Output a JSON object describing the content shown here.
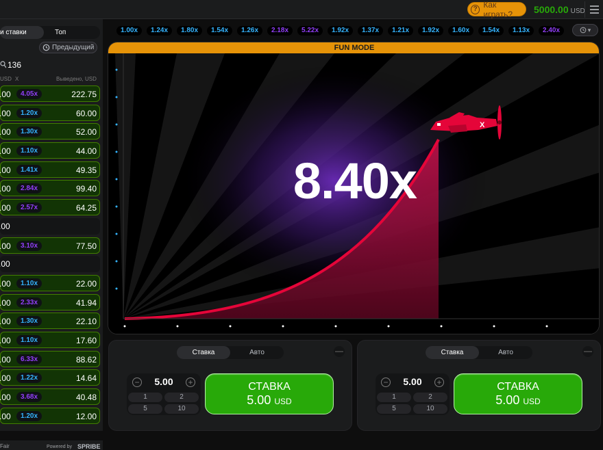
{
  "header": {
    "how_to_play": "Как играть?",
    "balance": "5000.00",
    "currency": "USD"
  },
  "left": {
    "tabs": [
      "и ставки",
      "Топ"
    ],
    "previous_label": "Предыдущий",
    "count": "136",
    "col_usd": "USD",
    "col_x": "X",
    "col_out": "Выведено, USD",
    "rows": [
      {
        "bet": ".00",
        "mult": "4.05x",
        "color": "purple",
        "out": "222.75",
        "win": true
      },
      {
        "bet": ".00",
        "mult": "1.20x",
        "color": "blue",
        "out": "60.00",
        "win": true
      },
      {
        "bet": ".00",
        "mult": "1.30x",
        "color": "blue",
        "out": "52.00",
        "win": true
      },
      {
        "bet": ".00",
        "mult": "1.10x",
        "color": "blue",
        "out": "44.00",
        "win": true
      },
      {
        "bet": ".00",
        "mult": "1.41x",
        "color": "blue",
        "out": "49.35",
        "win": true
      },
      {
        "bet": ".00",
        "mult": "2.84x",
        "color": "purple",
        "out": "99.40",
        "win": true
      },
      {
        "bet": ".00",
        "mult": "2.57x",
        "color": "purple",
        "out": "64.25",
        "win": true
      },
      {
        "bet": ".00",
        "mult": "",
        "color": "",
        "out": "",
        "win": false
      },
      {
        "bet": ".00",
        "mult": "3.10x",
        "color": "purple",
        "out": "77.50",
        "win": true
      },
      {
        "bet": ".00",
        "mult": "",
        "color": "",
        "out": "",
        "win": false
      },
      {
        "bet": ".00",
        "mult": "1.10x",
        "color": "blue",
        "out": "22.00",
        "win": true
      },
      {
        "bet": ".00",
        "mult": "2.33x",
        "color": "purple",
        "out": "41.94",
        "win": true
      },
      {
        "bet": ".00",
        "mult": "1.30x",
        "color": "blue",
        "out": "22.10",
        "win": true
      },
      {
        "bet": ".00",
        "mult": "1.10x",
        "color": "blue",
        "out": "17.60",
        "win": true
      },
      {
        "bet": ".00",
        "mult": "6.33x",
        "color": "purple",
        "out": "88.62",
        "win": true
      },
      {
        "bet": ".00",
        "mult": "1.22x",
        "color": "blue",
        "out": "14.64",
        "win": true
      },
      {
        "bet": ".00",
        "mult": "3.68x",
        "color": "purple",
        "out": "40.48",
        "win": true
      },
      {
        "bet": ".00",
        "mult": "1.20x",
        "color": "blue",
        "out": "12.00",
        "win": true
      }
    ],
    "footer_left": "Fair",
    "footer_right": "Powered by",
    "footer_brand": "SPRIBE"
  },
  "history": [
    {
      "v": "1.00x",
      "c": "blue"
    },
    {
      "v": "1.24x",
      "c": "blue"
    },
    {
      "v": "1.80x",
      "c": "blue"
    },
    {
      "v": "1.54x",
      "c": "blue"
    },
    {
      "v": "1.26x",
      "c": "blue"
    },
    {
      "v": "2.18x",
      "c": "purple"
    },
    {
      "v": "5.22x",
      "c": "purple"
    },
    {
      "v": "1.92x",
      "c": "blue"
    },
    {
      "v": "1.37x",
      "c": "blue"
    },
    {
      "v": "1.21x",
      "c": "blue"
    },
    {
      "v": "1.92x",
      "c": "blue"
    },
    {
      "v": "1.60x",
      "c": "blue"
    },
    {
      "v": "1.54x",
      "c": "blue"
    },
    {
      "v": "1.13x",
      "c": "blue"
    },
    {
      "v": "2.40x",
      "c": "purple"
    }
  ],
  "game": {
    "mode_label": "FUN MODE",
    "multiplier": "8.40x"
  },
  "panels": [
    {
      "tab_bet": "Ставка",
      "tab_auto": "Авто",
      "amount": "5.00",
      "chips": [
        "1",
        "2",
        "5",
        "10"
      ],
      "btn_label": "СТАВКА",
      "btn_amount": "5.00",
      "btn_currency": "USD",
      "minus": "—"
    },
    {
      "tab_bet": "Ставка",
      "tab_auto": "Авто",
      "amount": "5.00",
      "chips": [
        "1",
        "2",
        "5",
        "10"
      ],
      "btn_label": "СТАВКА",
      "btn_amount": "5.00",
      "btn_currency": "USD",
      "minus": "—"
    }
  ],
  "colors": {
    "accent": "#e69308",
    "green": "#28a909",
    "blue": "#34b4ff",
    "purple": "#913ef8",
    "curve": "#e50539"
  }
}
